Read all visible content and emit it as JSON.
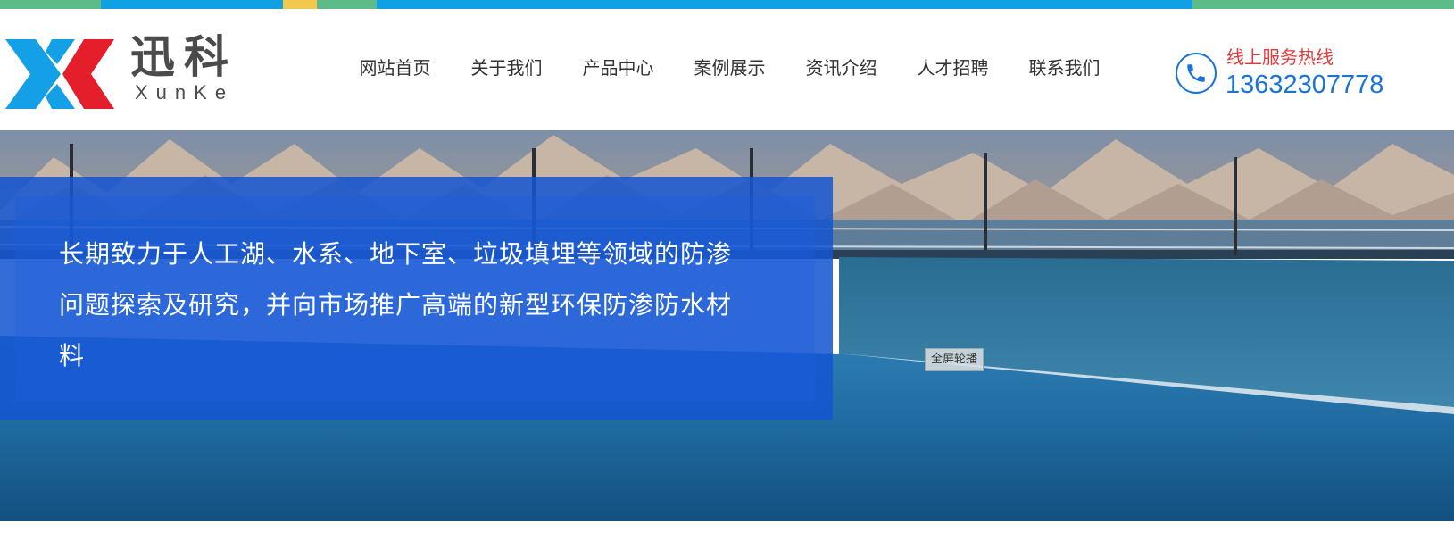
{
  "colors": {
    "strip": [
      "#5dbb8a",
      "#12a0e4",
      "#f2c94c",
      "#5dbb8a",
      "#12a0e4",
      "#5dbb8a"
    ],
    "brand_blue": "#1a73d9",
    "hotline_red": "#e23b3b",
    "logo_cyan": "#14a0e6",
    "logo_red": "#e41e2b"
  },
  "logo": {
    "cn": "迅科",
    "en": "XunKe"
  },
  "nav": {
    "items": [
      {
        "label": "网站首页"
      },
      {
        "label": "关于我们"
      },
      {
        "label": "产品中心"
      },
      {
        "label": "案例展示"
      },
      {
        "label": "资讯介绍"
      },
      {
        "label": "人才招聘"
      },
      {
        "label": "联系我们"
      }
    ]
  },
  "hotline": {
    "icon": "phone-icon",
    "label": "线上服务热线",
    "number": "13632307778"
  },
  "banner": {
    "caption": "长期致力于人工湖、水系、地下室、垃圾填埋等领域的防渗问题探索及研究，并向市场推广高端的新型环保防渗防水材料",
    "fullscreen_label": "全屏轮播"
  }
}
